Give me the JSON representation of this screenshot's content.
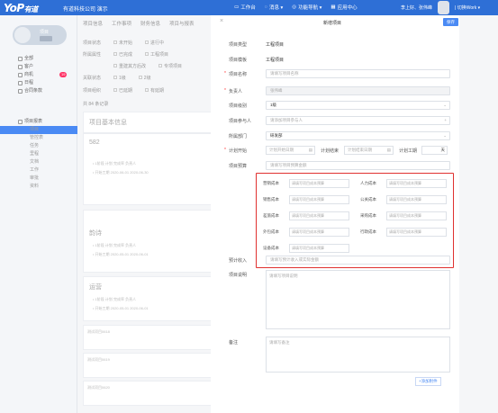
{
  "app": {
    "logo": "YoP",
    "logo_suffix": "有道",
    "company": "有道科技公司 演示"
  },
  "topnav": [
    {
      "icon": "desktop-icon",
      "label": "工作台"
    },
    {
      "icon": "chat-icon",
      "label": "消息 ▾"
    },
    {
      "icon": "compass-icon",
      "label": "功能导航 ▾"
    },
    {
      "icon": "grid-icon",
      "label": "应用中心"
    }
  ],
  "user": {
    "name": "李上好、张伟峰",
    "switch": "| 切换Work ▾"
  },
  "sidebar": {
    "project_label": "项目",
    "items": [
      {
        "icon": "home-icon",
        "label": "全部"
      },
      {
        "icon": "user-icon",
        "label": "客户"
      },
      {
        "icon": "list-icon",
        "label": "商机",
        "badge": "19"
      },
      {
        "icon": "calendar-icon",
        "label": "日程"
      },
      {
        "icon": "contract-icon",
        "label": "合同条款"
      }
    ],
    "section": "项目报表",
    "section_items": [
      "项目",
      "管控表",
      "任务",
      "里程",
      "文档",
      "工作",
      "审批",
      "资料"
    ]
  },
  "bg": {
    "tabs": [
      "项目信息",
      "工作事项",
      "财务信息",
      "项目与报表"
    ],
    "filters": [
      [
        "项目状态",
        "未开始",
        "进行中"
      ],
      [
        "所属属性",
        "已完成",
        "工程项目"
      ],
      [
        "",
        "重建其方后改",
        "专项项目"
      ],
      [
        "关联状态",
        "1级",
        "2级"
      ],
      [
        "项目组织",
        "已延期",
        "有延期"
      ]
    ],
    "count": "共 84 条记录",
    "cards": [
      {
        "title": "项目基本信息",
        "lines": []
      },
      {
        "title": "582",
        "lines": [
          "• 1阶段   计划   完成率   负责人",
          "• 开始工期  2020-06-01  2020-06-30"
        ]
      },
      {
        "title": "韵诗",
        "lines": [
          "• 1阶段   计划   完成率   负责人",
          "• 开始工期  2020-05-01  2020-06-01"
        ]
      },
      {
        "title": "运营",
        "lines": [
          "• 1阶段   计划   完成率   负责人",
          "• 开始工期  2020-05-01  2020-06-01"
        ]
      }
    ],
    "rows": [
      "测试项目0618",
      "测试项目0619",
      "测试项目0620"
    ]
  },
  "modal": {
    "title": "新增项目",
    "save": "保存",
    "close": "×",
    "fields": {
      "type": {
        "label": "项目类型",
        "value": "工程项目"
      },
      "template": {
        "label": "项目模板",
        "value": "工程项目"
      },
      "name": {
        "label": "项目名称",
        "placeholder": "请填写项目名称"
      },
      "owner": {
        "label": "负责人",
        "value": "张伟峰"
      },
      "level": {
        "label": "项目级别",
        "value": "1级"
      },
      "members": {
        "label": "项目参与人",
        "placeholder": "请添加项目参与人"
      },
      "dept": {
        "label": "所属部门",
        "value": "研发部"
      },
      "plan_start": {
        "label": "计划开始",
        "placeholder": "计划开始日期"
      },
      "plan_end": {
        "label": "计划结束",
        "placeholder": "计划结束日期"
      },
      "duration": {
        "label": "计划工期",
        "unit": "天"
      },
      "budget": {
        "label": "项目预算",
        "placeholder": "请填写项目预算金额"
      },
      "income": {
        "label": "预计收入",
        "placeholder": "请填写预计收入或实际金额"
      },
      "desc": {
        "label": "项目说明",
        "placeholder": "请填写项目说明"
      },
      "remark": {
        "label": "备注",
        "placeholder": "请填写备注"
      }
    },
    "costs": [
      {
        "label": "营销成本",
        "placeholder": "请填写项目成本预算"
      },
      {
        "label": "人力成本",
        "placeholder": "请填写项目成本预算"
      },
      {
        "label": "销售成本",
        "placeholder": "请填写项目成本预算"
      },
      {
        "label": "公关成本",
        "placeholder": "请填写项目成本预算"
      },
      {
        "label": "差旅成本",
        "placeholder": "请填写项目成本预算"
      },
      {
        "label": "采购成本",
        "placeholder": "请填写项目成本预算"
      },
      {
        "label": "外包成本",
        "placeholder": "请填写项目成本预算"
      },
      {
        "label": "行政成本",
        "placeholder": "请填写项目成本预算"
      },
      {
        "label": "设备成本",
        "placeholder": "请填写项目成本预算"
      }
    ],
    "attach": "+添加附件",
    "highlight_color": "#e0312f",
    "accent": "#4a8af4"
  }
}
